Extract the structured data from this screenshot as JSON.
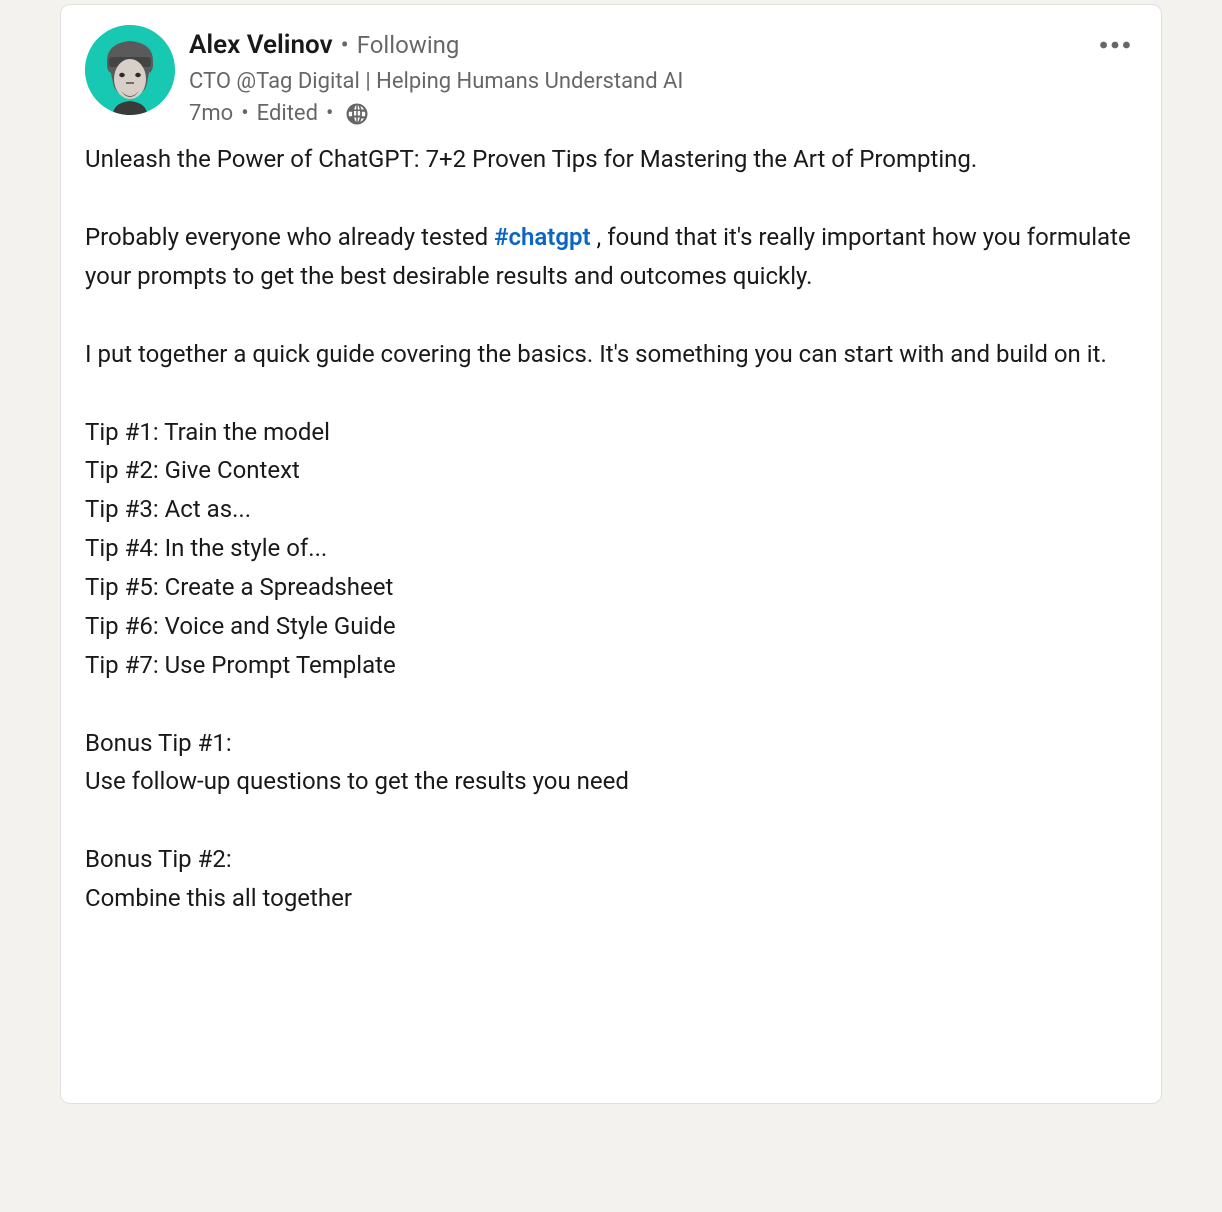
{
  "author": {
    "name": "Alex Velinov",
    "separator": "•",
    "follow_status": "Following",
    "headline": "CTO @Tag Digital | Helping Humans Understand AI"
  },
  "meta": {
    "time": "7mo",
    "dot": "•",
    "edited": "Edited",
    "visibility_icon": "globe"
  },
  "body": {
    "para1": "Unleash the Power of ChatGPT: 7+2 Proven Tips for Mastering the Art of Prompting.",
    "para2_pre": "Probably everyone who already tested ",
    "hashtag": "#chatgpt",
    "para2_post": " , found that it's really important how you formulate your prompts to get the best desirable results and outcomes quickly.",
    "para3": "I put together a quick guide covering the basics. It's something you can start with and build on it.",
    "tips": [
      "Tip #1: Train the model",
      "Tip #2: Give Context",
      "Tip #3: Act as...",
      "Tip #4: In the style of...",
      "Tip #5: Create a Spreadsheet",
      "Tip #6: Voice and Style Guide",
      "Tip #7: Use Prompt Template"
    ],
    "bonus1_title": "Bonus Tip #1:",
    "bonus1_text": "Use follow-up questions to get the results you need",
    "bonus2_title": "Bonus Tip #2:",
    "bonus2_text": "Combine this all together"
  }
}
